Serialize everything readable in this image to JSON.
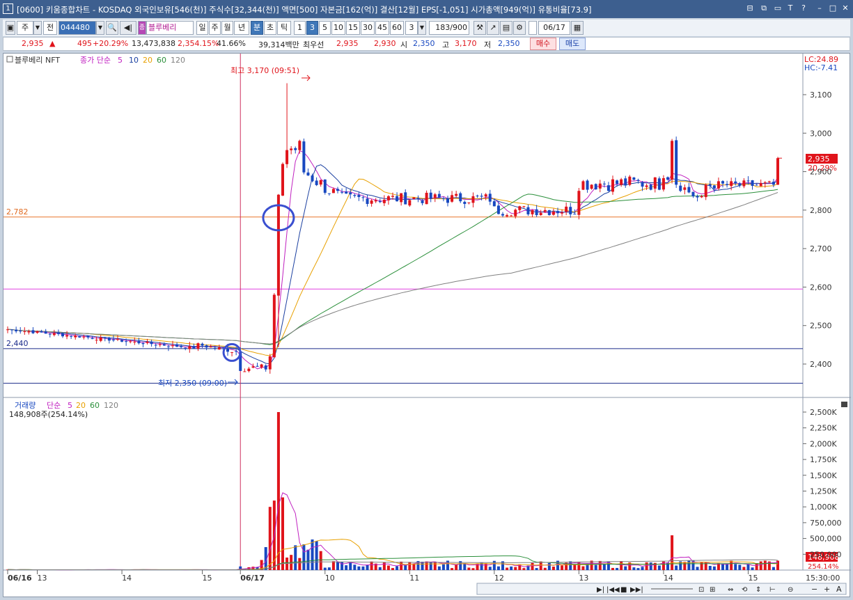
{
  "window": {
    "index": "1",
    "title": "[0600] 키움종합차트 - KOSDAQ 외국인보유[546(천)] 주식수[32,344(천)] 액면[500] 자본금[162(억)] 결산[12월] EPS[-1,051] 시가총액[949(억)] 유통비율[73.9]"
  },
  "toolbar": {
    "period_type": "주",
    "prev_label": "전",
    "code": "044480",
    "name": "블루베리",
    "name_prefix": "종",
    "periods": [
      "일",
      "주",
      "월",
      "년",
      "분",
      "초",
      "틱"
    ],
    "selected_period": "분",
    "intervals": [
      "1",
      "3",
      "5",
      "10",
      "15",
      "30",
      "45",
      "60"
    ],
    "selected_interval": "3",
    "interval_value": "3",
    "count": "183",
    "count_max": "/900",
    "date": "06/17"
  },
  "quote": {
    "price": "2,935",
    "arrow": "▲",
    "change": "495",
    "change_pct": "+20.29%",
    "volume": "13,473,838",
    "volume_pct": "2,354.15%",
    "turnover": "41.66%",
    "amount": "39,314백만",
    "ask_label": "최우선",
    "ask": "2,935",
    "bid": "2,930",
    "open_label": "시",
    "open": "2,350",
    "high_label": "고",
    "high": "3,170",
    "low_label": "저",
    "low": "2,350",
    "buy_label": "매수",
    "sell_label": "매도"
  },
  "price_pane": {
    "legend_name": "블루베리 NFT",
    "legend_type": "종가 단순",
    "ma_labels": [
      "5",
      "10",
      "20",
      "60",
      "120"
    ],
    "lc": "LC:24.89",
    "hc": "HC:-7.41",
    "high_annot": "최고 3,170 (09:51)",
    "low_annot": "최저 2,350 (09:00)",
    "line_2782": "2,782",
    "line_2440": "2,440",
    "current_price": "2,935",
    "current_pct": "20.29%",
    "y_ticks": [
      "3,100",
      "3,000",
      "2,900",
      "2,800",
      "2,700",
      "2,600",
      "2,500",
      "2,400"
    ]
  },
  "volume_pane": {
    "legend_name": "거래량",
    "legend_type": "단순",
    "ma_labels": [
      "5",
      "20",
      "60",
      "120"
    ],
    "current": "148,908주(254.14%)",
    "current_label": "148,908",
    "current_pct": "254.14%",
    "y_ticks": [
      "2,500K",
      "2,250K",
      "2,000K",
      "1,750K",
      "1,500K",
      "1,250K",
      "1,000K",
      "750,000",
      "500,000",
      "250,000"
    ]
  },
  "x_axis": {
    "labels": [
      "06/16",
      "13",
      "14",
      "15",
      "06/17",
      "10",
      "11",
      "12",
      "13",
      "14",
      "15"
    ],
    "time": "15:30:00"
  },
  "colors": {
    "up": "#e0141b",
    "down": "#1848c0",
    "ma5": "#c020c0",
    "ma10": "#1a3fa0",
    "ma20": "#e8a000",
    "ma60": "#2a8f3a",
    "ma120": "#808080"
  }
}
